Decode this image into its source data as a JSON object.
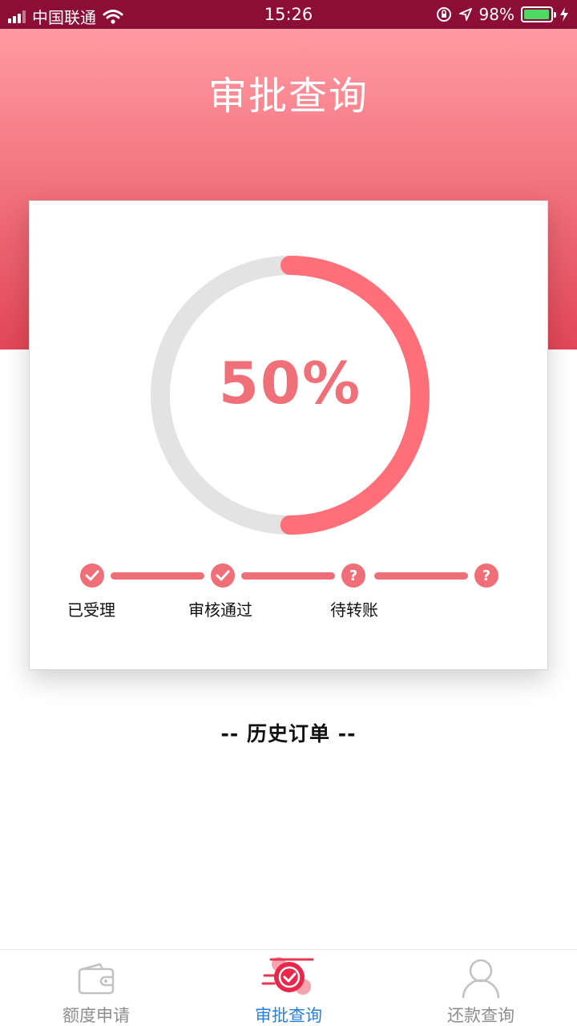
{
  "status_bar": {
    "carrier": "中国联通",
    "time": "15:26",
    "battery": "98%",
    "battery_level": 0.98,
    "icons": [
      "signal-icon",
      "wifi-icon",
      "orientation-lock-icon",
      "location-arrow-icon",
      "battery-icon",
      "charging-bolt-icon"
    ]
  },
  "header": {
    "title": "审批查询"
  },
  "progress": {
    "percent_text": "50%",
    "value": 0.5,
    "track_color": "#e3e3e3",
    "fill_color": "#ff6f79"
  },
  "steps": [
    {
      "label": "已受理",
      "state": "done",
      "icon": "check-icon"
    },
    {
      "label": "审核通过",
      "state": "done",
      "icon": "check-icon"
    },
    {
      "label": "待转账",
      "state": "pending",
      "icon": "question-icon"
    },
    {
      "label": "",
      "state": "pending",
      "icon": "question-icon"
    }
  ],
  "history": {
    "title": "-- 历史订单 --"
  },
  "tab_bar": {
    "tabs": [
      {
        "label": "额度申请",
        "icon": "wallet-icon",
        "active": false
      },
      {
        "label": "审批查询",
        "icon": "approval-check-icon",
        "active": true
      },
      {
        "label": "还款查询",
        "icon": "user-icon",
        "active": false
      }
    ],
    "active_color": "#2a7fdc",
    "inactive_color": "#8e8e8e"
  }
}
